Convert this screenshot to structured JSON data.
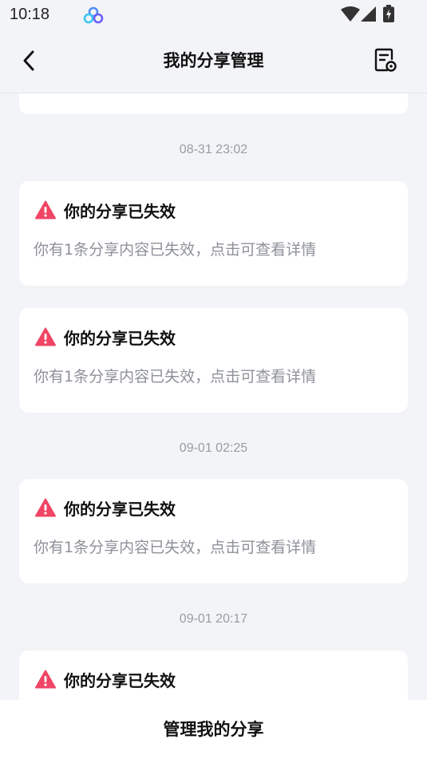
{
  "status_bar": {
    "time": "10:18",
    "app_icon": "cloud-drive-icon",
    "icons": [
      "wifi-icon",
      "signal-icon",
      "battery-charging-icon"
    ]
  },
  "header": {
    "title": "我的分享管理",
    "back_icon": "back-arrow-icon",
    "right_icon": "share-record-settings-icon"
  },
  "timestamps": [
    "08-31 23:02",
    "09-01 02:25",
    "09-01 20:17"
  ],
  "cards": [
    {
      "title": "你的分享已失效",
      "description": "你有1条分享内容已失效，点击可查看详情"
    },
    {
      "title": "你的分享已失效",
      "description": "你有1条分享内容已失效，点击可查看详情"
    },
    {
      "title": "你的分享已失效",
      "description": "你有1条分享内容已失效，点击可查看详情"
    },
    {
      "title": "你的分享已失效"
    }
  ],
  "bottom_bar": {
    "label": "管理我的分享"
  },
  "colors": {
    "background": "#f3f4f7",
    "card": "#ffffff",
    "warning": "#f04565",
    "muted_text": "#8e9199"
  }
}
